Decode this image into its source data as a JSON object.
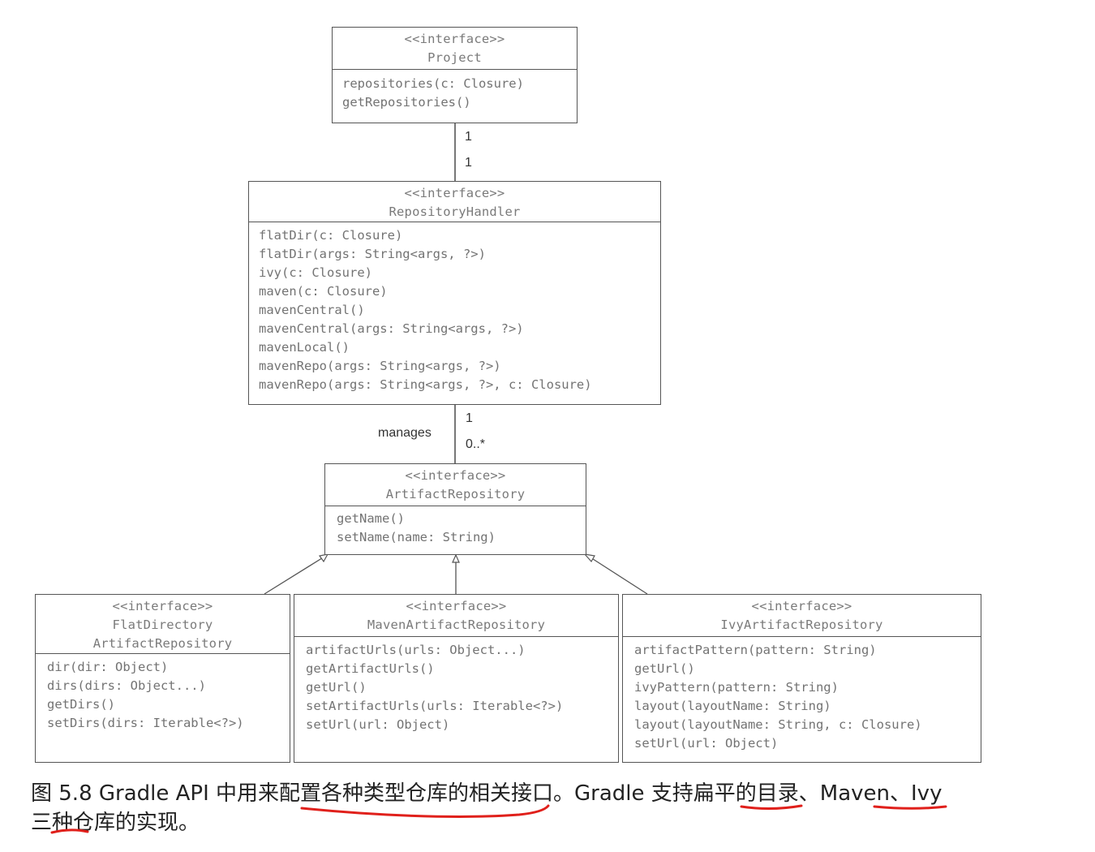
{
  "diagram": {
    "boxes": {
      "project": {
        "stereotype": "<<interface>>",
        "name": "Project",
        "methods": [
          "repositories(c: Closure)",
          "getRepositories()"
        ]
      },
      "repository_handler": {
        "stereotype": "<<interface>>",
        "name": "RepositoryHandler",
        "methods": [
          "flatDir(c: Closure)",
          "flatDir(args: String<args, ?>)",
          "ivy(c: Closure)",
          "maven(c: Closure)",
          "mavenCentral()",
          "mavenCentral(args: String<args, ?>)",
          "mavenLocal()",
          "mavenRepo(args: String<args, ?>)",
          "mavenRepo(args: String<args, ?>, c: Closure)"
        ]
      },
      "artifact_repository": {
        "stereotype": "<<interface>>",
        "name": "ArtifactRepository",
        "methods": [
          "getName()",
          "setName(name: String)"
        ]
      },
      "flat_directory": {
        "stereotype": "<<interface>>",
        "name_line1": "FlatDirectory",
        "name_line2": "ArtifactRepository",
        "methods": [
          "dir(dir: Object)",
          "dirs(dirs: Object...)",
          "getDirs()",
          "setDirs(dirs: Iterable<?>)"
        ]
      },
      "maven_artifact": {
        "stereotype": "<<interface>>",
        "name": "MavenArtifactRepository",
        "methods": [
          "artifactUrls(urls: Object...)",
          "getArtifactUrls()",
          "getUrl()",
          "setArtifactUrls(urls: Iterable<?>)",
          "setUrl(url: Object)"
        ]
      },
      "ivy_artifact": {
        "stereotype": "<<interface>>",
        "name": "IvyArtifactRepository",
        "methods": [
          "artifactPattern(pattern: String)",
          "getUrl()",
          "ivyPattern(pattern: String)",
          "layout(layoutName: String)",
          "layout(layoutName: String, c: Closure)",
          "setUrl(url: Object)"
        ]
      }
    },
    "associations": {
      "project_to_handler": {
        "source_mult": "1",
        "target_mult": "1"
      },
      "handler_to_repository": {
        "label": "manages",
        "source_mult": "1",
        "target_mult": "0..*"
      }
    }
  },
  "caption": {
    "line1": "图 5.8  Gradle API 中用来配置各种类型仓库的相关接口。Gradle 支持扁平的目录、Maven、Ivy",
    "line2": "三种仓库的实现。"
  },
  "colors": {
    "border": "#555555",
    "text": "#737373",
    "annotation": "#e0201b"
  }
}
